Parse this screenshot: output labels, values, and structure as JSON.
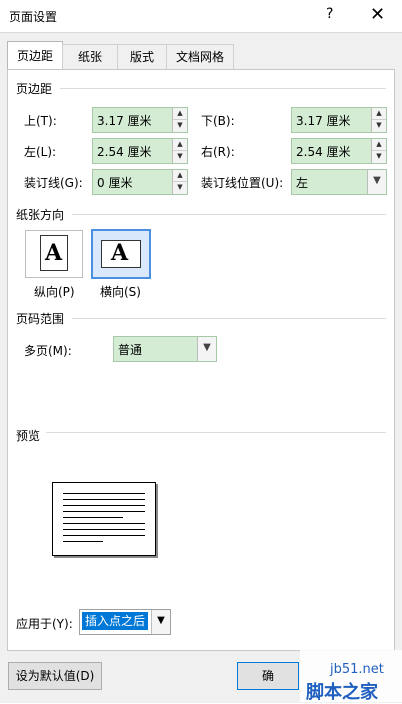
{
  "window": {
    "title": "页面设置",
    "help": "?",
    "close": "✕"
  },
  "tabs": [
    "页边距",
    "纸张",
    "版式",
    "文档网格"
  ],
  "margins": {
    "section": "页边距",
    "top": {
      "label": "上(T):",
      "value": "3.17 厘米"
    },
    "bottom": {
      "label": "下(B):",
      "value": "3.17 厘米"
    },
    "left": {
      "label": "左(L):",
      "value": "2.54 厘米"
    },
    "right": {
      "label": "右(R):",
      "value": "2.54 厘米"
    },
    "gutter": {
      "label": "装订线(G):",
      "value": "0 厘米"
    },
    "gutter_pos": {
      "label": "装订线位置(U):",
      "value": "左"
    }
  },
  "orientation": {
    "section": "纸张方向",
    "portrait": {
      "label": "纵向(P)",
      "glyph": "A"
    },
    "landscape": {
      "label": "横向(S)",
      "glyph": "A"
    },
    "selected": "landscape"
  },
  "pages": {
    "section": "页码范围",
    "label": "多页(M):",
    "value": "普通"
  },
  "preview": {
    "section": "预览"
  },
  "apply": {
    "label": "应用于(Y):",
    "value": "插入点之后"
  },
  "buttons": {
    "set_default": "设为默认值(D)",
    "ok": "确"
  },
  "watermark": {
    "line1": "jb51.net",
    "line2": "脚本之家"
  }
}
